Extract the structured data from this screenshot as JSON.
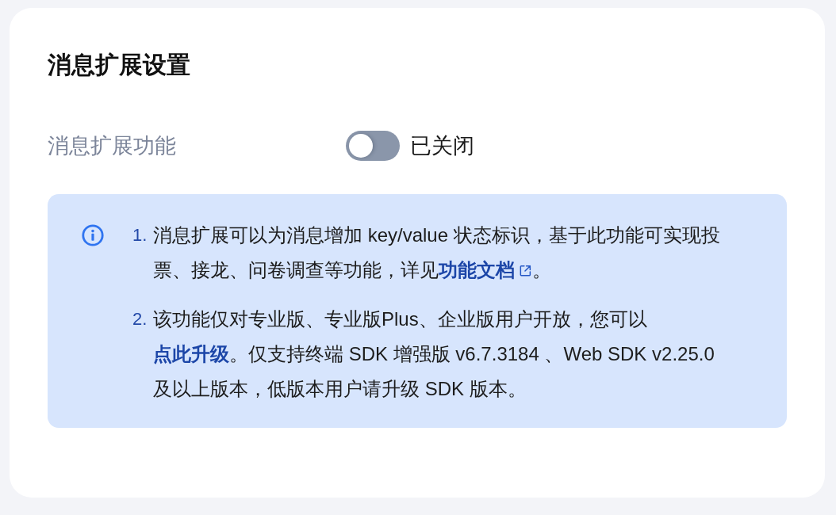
{
  "title": "消息扩展设置",
  "setting": {
    "label": "消息扩展功能",
    "on": false,
    "status": "已关闭"
  },
  "notice": {
    "items": [
      {
        "number": "1.",
        "parts": [
          {
            "kind": "text",
            "text": "消息扩展可以为消息增加 key/value 状态标识，基于此功能可实现投票、接龙、问卷调查等功能，详见"
          },
          {
            "kind": "link",
            "text": "功能文档",
            "external": true
          },
          {
            "kind": "text",
            "text": "。"
          }
        ]
      },
      {
        "number": "2.",
        "parts": [
          {
            "kind": "text",
            "text": "该功能仅对专业版、专业版Plus、企业版用户开放，您可以"
          },
          {
            "kind": "link",
            "text": "点此升级",
            "external": false
          },
          {
            "kind": "text",
            "text": "。仅支持终端 SDK 增强版 v6.7.3184 、Web SDK v2.25.0及以上版本，低版本用户请升级 SDK 版本。"
          }
        ]
      }
    ]
  }
}
